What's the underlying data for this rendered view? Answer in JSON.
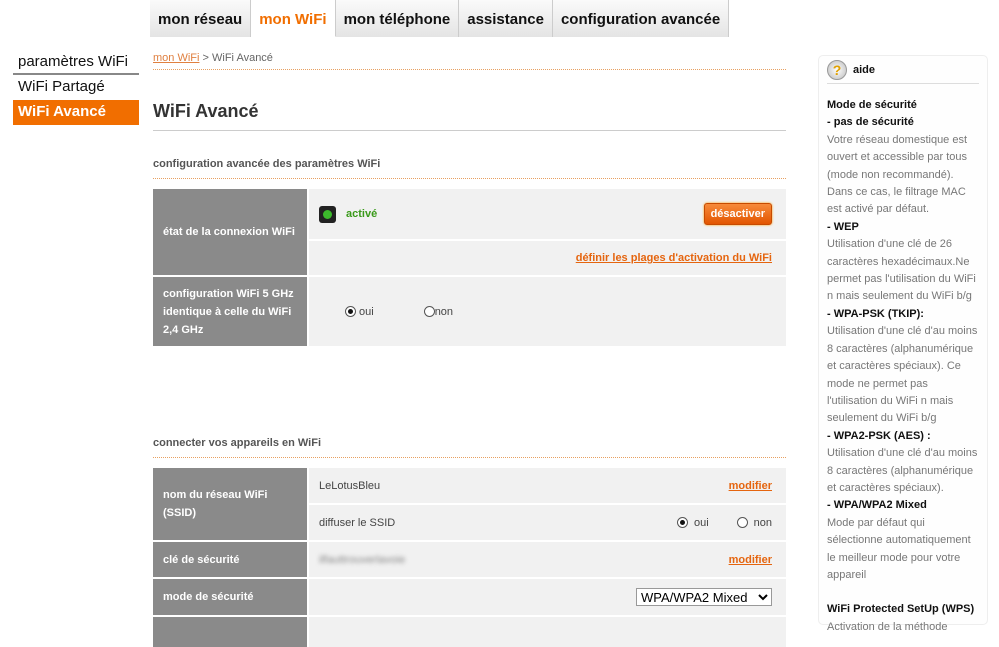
{
  "nav_tabs": [
    {
      "label": "mon réseau"
    },
    {
      "label": "mon WiFi",
      "active": true
    },
    {
      "label": "mon téléphone"
    },
    {
      "label": "assistance"
    },
    {
      "label": "configuration avancée"
    }
  ],
  "sidebar": {
    "items": [
      {
        "label": "paramètres WiFi"
      },
      {
        "label": "WiFi Partagé"
      },
      {
        "label": "WiFi Avancé",
        "active": true
      }
    ]
  },
  "breadcrumb": {
    "link": "mon WiFi",
    "separator": " > ",
    "current": "WiFi Avancé"
  },
  "page_title": "WiFi Avancé",
  "section1": {
    "title": "configuration avancée des paramètres WiFi",
    "wifi_state": {
      "label": "état de la connexion WiFi",
      "status": "activé",
      "button": "désactiver",
      "schedule_link": "définir les plages d'activation du WiFi"
    },
    "same_config": {
      "label": "configuration WiFi 5 GHz identique à celle du WiFi 2,4 GHz",
      "yes": "oui",
      "no": "non",
      "selected": "oui"
    }
  },
  "section2": {
    "title": "connecter vos appareils en WiFi",
    "ssid": {
      "label": "nom du réseau WiFi (SSID)",
      "value": "LeLotusBleu",
      "modify": "modifier",
      "broadcast_label": "diffuser le SSID",
      "yes": "oui",
      "no": "non",
      "selected": "oui"
    },
    "key": {
      "label": "clé de sécurité",
      "value": "ilfauttrouverlavoie",
      "modify": "modifier"
    },
    "mode": {
      "label": "mode de sécurité",
      "selected": "WPA/WPA2 Mixed"
    }
  },
  "help": {
    "title": "aide",
    "icon": "question-icon",
    "blocks": [
      {
        "h": "Mode de sécurité",
        "t": ""
      },
      {
        "h": "- pas de sécurité",
        "t": "Votre réseau domestique est ouvert et accessible par tous (mode non recommandé). Dans ce cas, le filtrage MAC est activé par défaut."
      },
      {
        "h": "- WEP",
        "t": "Utilisation d'une clé de 26 caractères hexadécimaux.Ne permet pas l'utilisation du WiFi n mais seulement du WiFi b/g"
      },
      {
        "h": "- WPA-PSK (TKIP):",
        "t": "Utilisation d'une clé d'au moins 8 caractères (alphanumérique et caractères spéciaux). Ce mode ne permet pas l'utilisation du WiFi n mais seulement du WiFi b/g"
      },
      {
        "h": "- WPA2-PSK (AES) :",
        "t": "Utilisation d'une clé d'au moins 8 caractères (alphanumérique et caractères spéciaux)."
      },
      {
        "h": "- WPA/WPA2 Mixed",
        "t": "Mode par défaut qui sélectionne automatiquement le meilleur mode pour votre appareil"
      },
      {
        "h": "WiFi Protected SetUp (WPS)",
        "t": "Activation de la méthode"
      }
    ]
  },
  "colors": {
    "accent": "#f16e00",
    "label_bg": "#8a8a8a",
    "cell_bg": "#f1f1f1",
    "status_green": "#3cba2c"
  }
}
